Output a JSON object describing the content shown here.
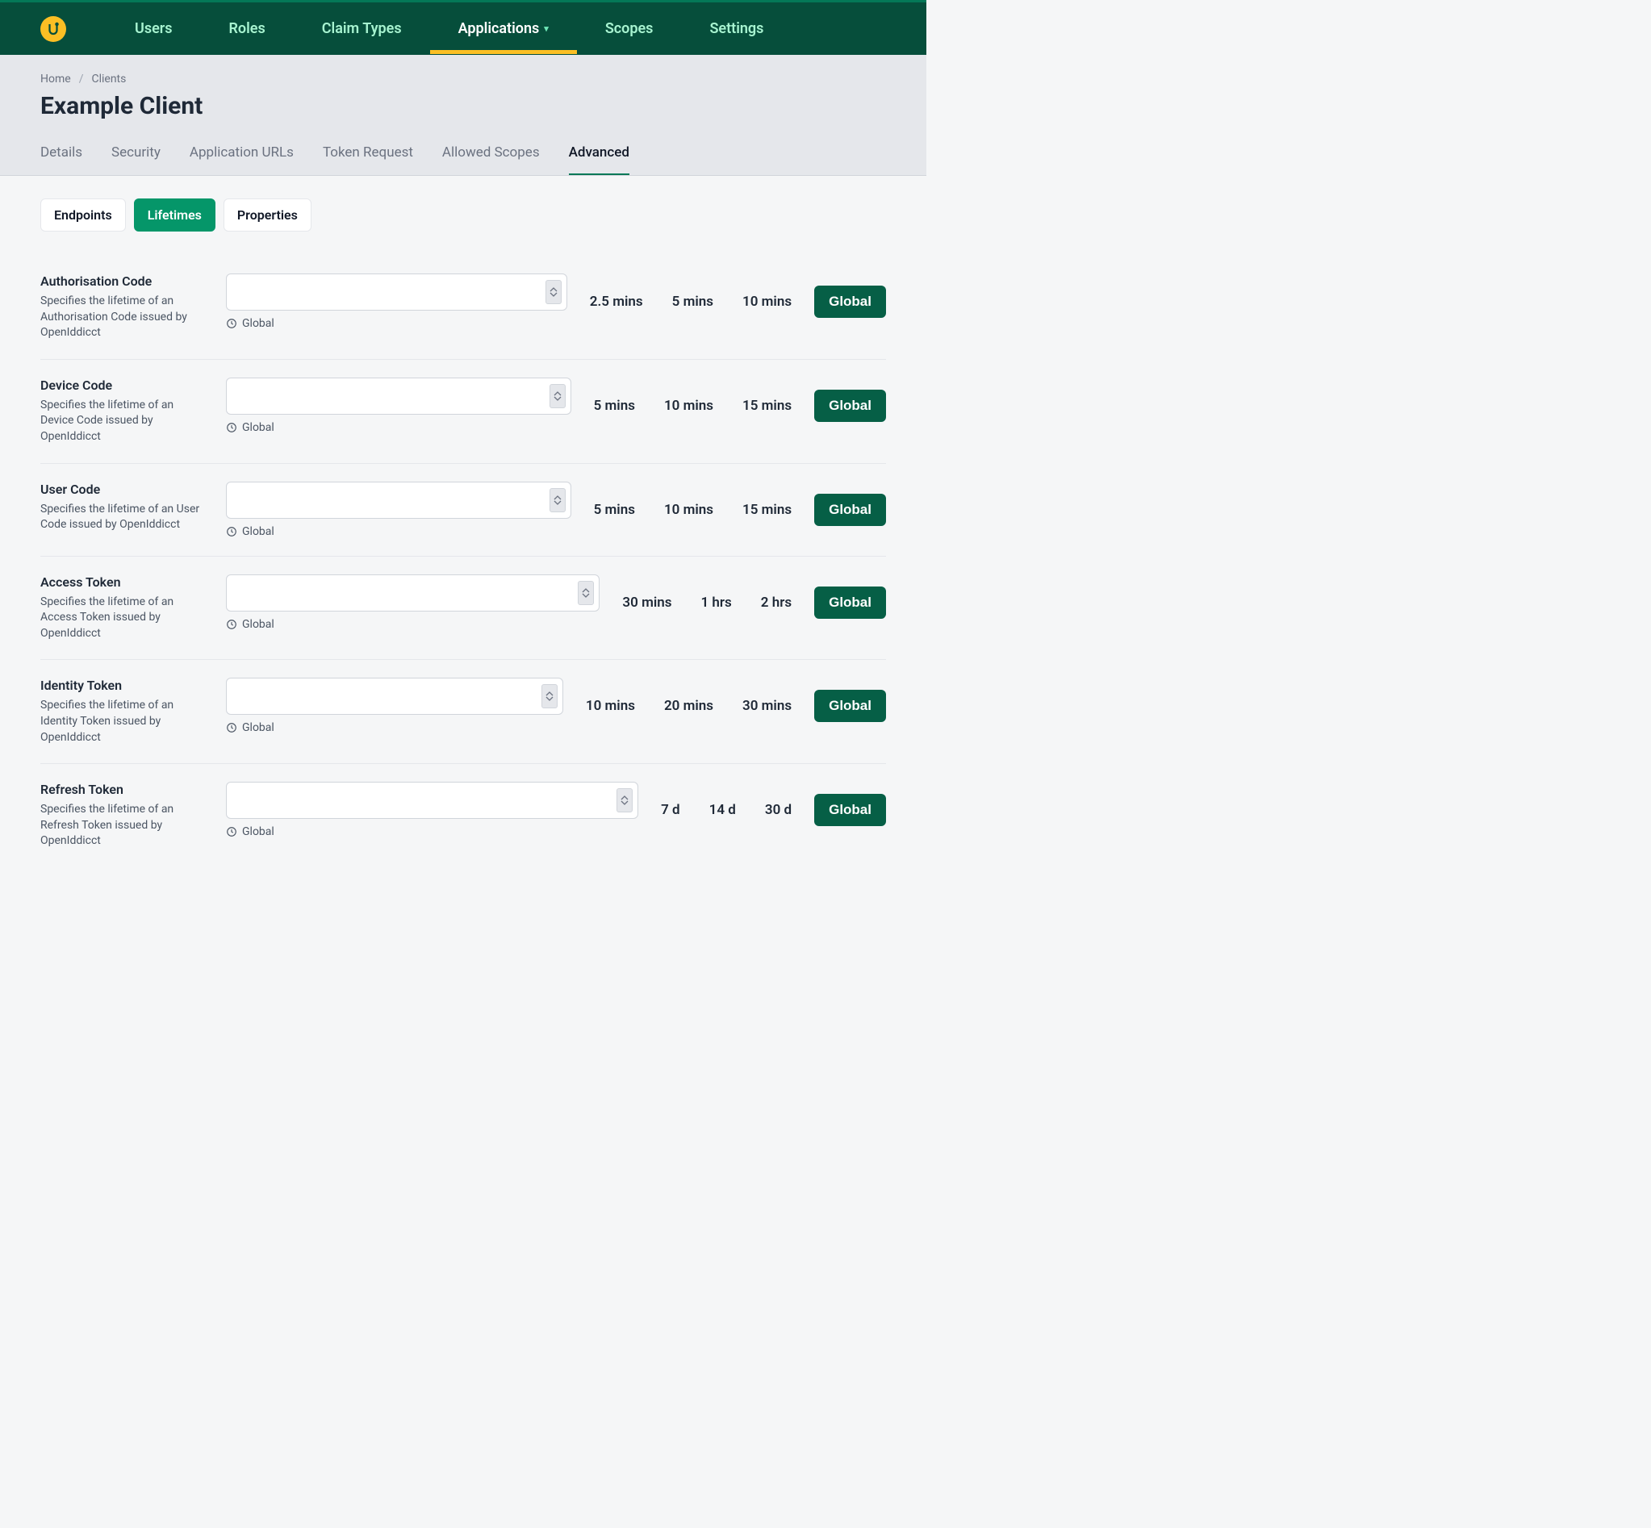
{
  "nav": {
    "items": [
      {
        "label": "Users"
      },
      {
        "label": "Roles"
      },
      {
        "label": "Claim Types"
      },
      {
        "label": "Applications",
        "active": true,
        "dropdown": true
      },
      {
        "label": "Scopes"
      },
      {
        "label": "Settings"
      }
    ]
  },
  "breadcrumb": {
    "home": "Home",
    "clients": "Clients"
  },
  "page_title": "Example Client",
  "tabs": [
    {
      "label": "Details"
    },
    {
      "label": "Security"
    },
    {
      "label": "Application URLs"
    },
    {
      "label": "Token Request"
    },
    {
      "label": "Allowed Scopes"
    },
    {
      "label": "Advanced",
      "active": true
    }
  ],
  "subtabs": [
    {
      "label": "Endpoints"
    },
    {
      "label": "Lifetimes",
      "active": true
    },
    {
      "label": "Properties"
    }
  ],
  "global_label": "Global",
  "hint_label": "Global",
  "rows": [
    {
      "title": "Authorisation Code",
      "desc": "Specifies the lifetime of an Authorisation Code issued by OpenIddicct",
      "presets": [
        "2.5 mins",
        "5 mins",
        "10 mins"
      ]
    },
    {
      "title": "Device Code",
      "desc": "Specifies the lifetime of an Device Code issued by OpenIddicct",
      "presets": [
        "5 mins",
        "10 mins",
        "15 mins"
      ]
    },
    {
      "title": "User Code",
      "desc": "Specifies the lifetime of an User Code issued by OpenIddicct",
      "presets": [
        "5 mins",
        "10 mins",
        "15 mins"
      ]
    },
    {
      "title": "Access Token",
      "desc": "Specifies the lifetime of an Access Token issued by OpenIddicct",
      "presets": [
        "30 mins",
        "1 hrs",
        "2 hrs"
      ]
    },
    {
      "title": "Identity Token",
      "desc": "Specifies the lifetime of an Identity Token issued by OpenIddicct",
      "presets": [
        "10 mins",
        "20 mins",
        "30 mins"
      ]
    },
    {
      "title": "Refresh Token",
      "desc": "Specifies the lifetime of an Refresh Token issued by OpenIddicct",
      "presets": [
        "7 d",
        "14 d",
        "30 d"
      ]
    }
  ]
}
